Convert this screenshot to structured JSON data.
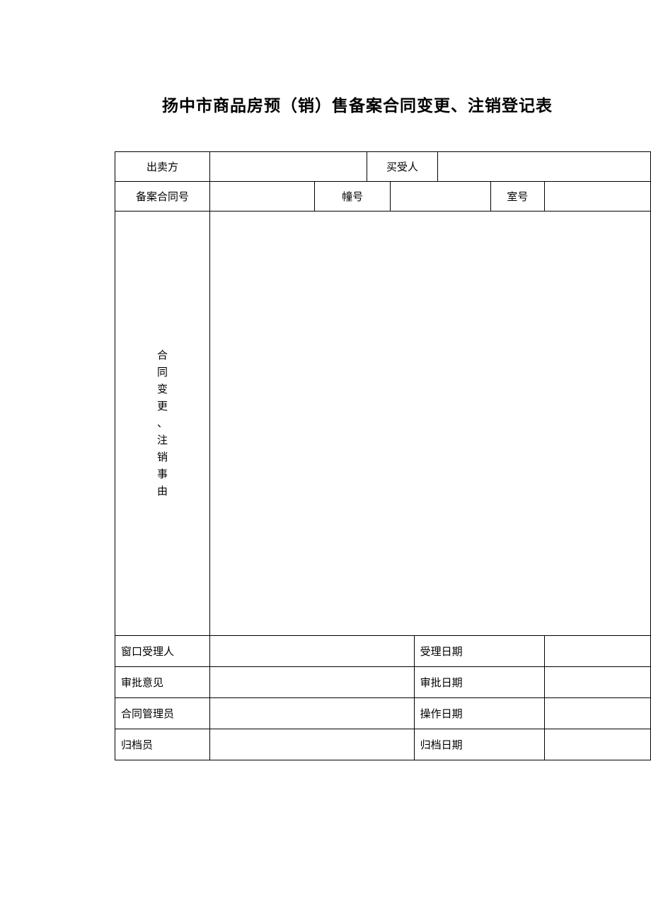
{
  "title": "扬中市商品房预（销）售备案合同变更、注销登记表",
  "row1": {
    "seller_label": "出卖方",
    "seller_value": "",
    "buyer_label": "买受人",
    "buyer_value": ""
  },
  "row2": {
    "contract_no_label": "备案合同号",
    "contract_no_value": "",
    "building_label": "幢号",
    "building_value": "",
    "room_label": "室号",
    "room_value": ""
  },
  "reason": {
    "label_chars": [
      "合",
      "同",
      "变",
      "更",
      "、",
      "注",
      "销",
      "事",
      "由"
    ],
    "content": ""
  },
  "bottom": {
    "receiver_label": "窗口受理人",
    "receiver_value": "",
    "receive_date_label": "受理日期",
    "receive_date_value": "",
    "approve_label": "审批意见",
    "approve_value": "",
    "approve_date_label": "审批日期",
    "approve_date_value": "",
    "manager_label": "合同管理员",
    "manager_value": "",
    "operate_date_label": "操作日期",
    "operate_date_value": "",
    "archive_label": "归档员",
    "archive_value": "",
    "archive_date_label": "归档日期",
    "archive_date_value": ""
  }
}
